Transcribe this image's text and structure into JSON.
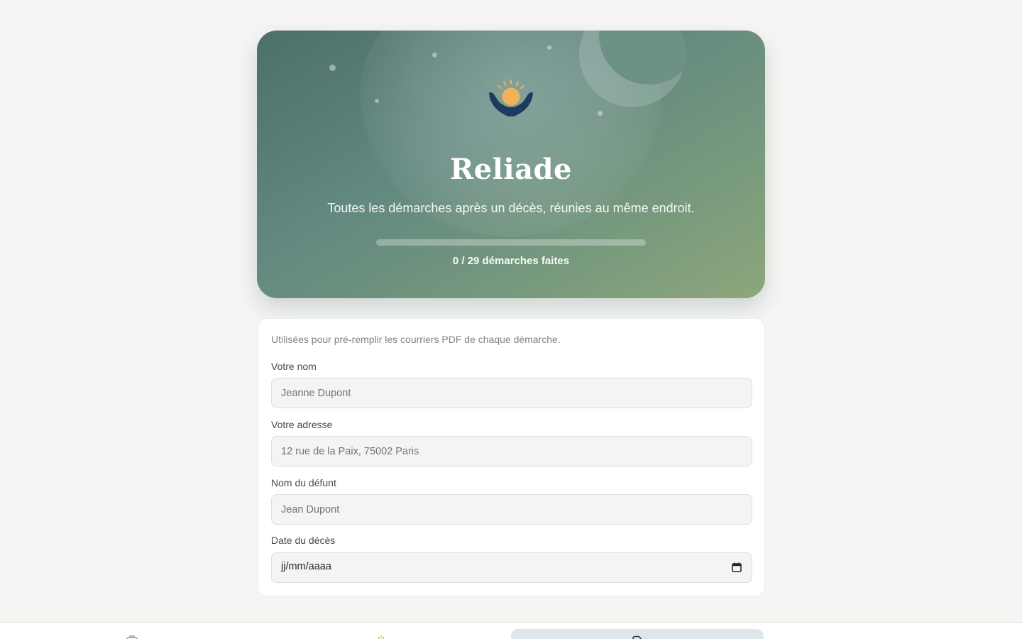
{
  "hero": {
    "title": "Reliade",
    "subtitle": "Toutes les démarches après un décès, réunies au même endroit.",
    "progress": {
      "done": 0,
      "total": 29,
      "fraction": 0.0
    },
    "progress_label": "0 / 29 démarches faites",
    "logo_icon": "hands-holding-sun-icon"
  },
  "form": {
    "intro": "Utilisées pour pré-remplir les courriers PDF de chaque démarche.",
    "fields": [
      {
        "label": "Votre nom",
        "placeholder": "Jeanne Dupont",
        "value": ""
      },
      {
        "label": "Votre adresse",
        "placeholder": "12 rue de la Paix, 75002 Paris",
        "value": ""
      },
      {
        "label": "Nom du défunt",
        "placeholder": "Jean Dupont",
        "value": ""
      },
      {
        "label": "Date du décès",
        "placeholder": "jj/mm/aaaa",
        "value": ""
      }
    ]
  },
  "bottom_nav": {
    "items": [
      {
        "icon": "briefcase-icon",
        "active": false
      },
      {
        "icon": "sun-icon",
        "active": false
      },
      {
        "icon": "document-icon",
        "active": true
      }
    ]
  },
  "colors": {
    "background": "#f5f5f3",
    "hero_start": "#4d6f69",
    "hero_end": "#8ea77b",
    "logo_sun": "#f0b25a",
    "logo_hands": "#1f3a5c",
    "nav_active": "#dfe6ea"
  }
}
